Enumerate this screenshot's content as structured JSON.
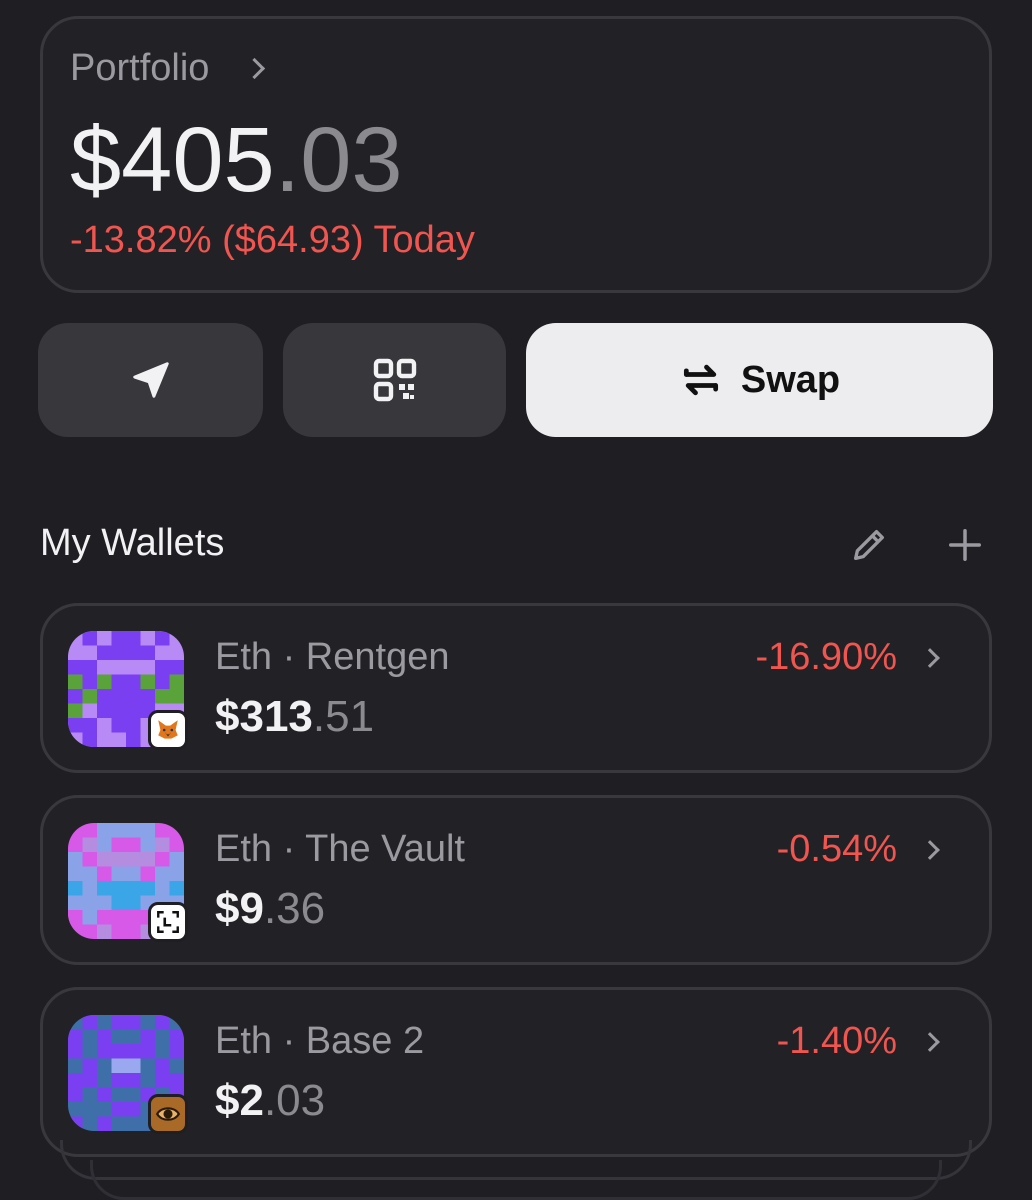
{
  "portfolio": {
    "label": "Portfolio",
    "balance_int": "$405",
    "balance_dec": ".03",
    "change": "-13.82% ($64.93) Today"
  },
  "actions": {
    "send_icon": "send-arrow-icon",
    "qr_icon": "qr-code-icon",
    "swap_label": "Swap",
    "swap_icon": "swap-arrows-icon"
  },
  "wallets_section": {
    "title": "My Wallets",
    "edit_icon": "pencil-icon",
    "add_icon": "plus-icon"
  },
  "wallets": [
    {
      "name": "Eth · Rentgen",
      "balance_int": "$313",
      "balance_dec": ".51",
      "change": "-16.90%",
      "badge": "metamask-fox-icon"
    },
    {
      "name": "Eth · The Vault",
      "balance_int": "$9",
      "balance_dec": ".36",
      "change": "-0.54%",
      "badge": "ledger-icon"
    },
    {
      "name": "Eth · Base 2",
      "balance_int": "$2",
      "balance_dec": ".03",
      "change": "-1.40%",
      "badge": "eye-watch-icon"
    }
  ],
  "colors": {
    "background": "#1f1f23",
    "negative": "#f0554f",
    "swap_button": "#ededf0"
  }
}
